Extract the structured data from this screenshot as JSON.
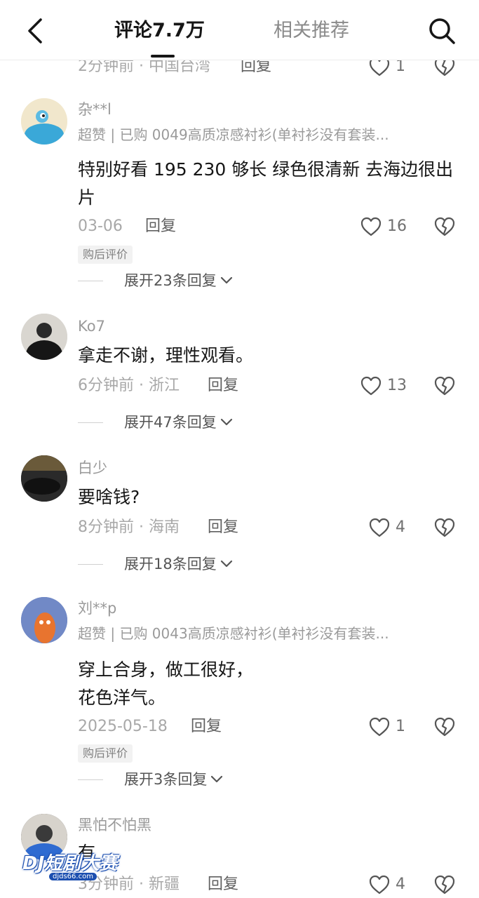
{
  "header": {
    "tab_comments": "评论7.7万",
    "tab_related": "相关推荐"
  },
  "partial_row": {
    "meta": "2分钟前 · 中国台湾",
    "reply": "回复",
    "likes": "1"
  },
  "comments": [
    {
      "username": "杂**l",
      "purchase": "超赞 | 已购 0049高质凉感衬衫(单衬衫没有套装...",
      "text": "特别好看 195 230 够长 绿色很清新 去海边很出片",
      "meta": "03-06",
      "reply": "回复",
      "likes": "16",
      "badge": "购后评价",
      "expand": "展开23条回复"
    },
    {
      "username": "Ko7",
      "text": "拿走不谢，理性观看。",
      "meta": "6分钟前 · 浙江",
      "reply": "回复",
      "likes": "13",
      "expand": "展开47条回复"
    },
    {
      "username": "白少",
      "text": "要啥钱?",
      "meta": "8分钟前 · 海南",
      "reply": "回复",
      "likes": "4",
      "expand": "展开18条回复"
    },
    {
      "username": "刘**p",
      "purchase": "超赞 | 已购 0043高质凉感衬衫(单衬衫没有套装...",
      "text_line1": "穿上合身，做工很好，",
      "text_line2": "花色洋气。",
      "meta": "2025-05-18",
      "reply": "回复",
      "likes": "1",
      "badge": "购后评价",
      "expand": "展开3条回复"
    },
    {
      "username": "黑怕不怕黑",
      "text": "有",
      "meta": "3分钟前 · 新疆",
      "reply": "回复",
      "likes": "4"
    }
  ],
  "watermark": {
    "main": "DJ短剧大赛",
    "sub": "djds66.com"
  },
  "colors": {
    "text_primary": "#161616",
    "text_secondary": "#9a9a9a",
    "badge_bg": "#f2f2f2",
    "watermark_blue": "#1c4fb0"
  },
  "icons": [
    "back-arrow-icon",
    "search-icon",
    "heart-icon",
    "broken-heart-icon",
    "chevron-down-icon"
  ]
}
